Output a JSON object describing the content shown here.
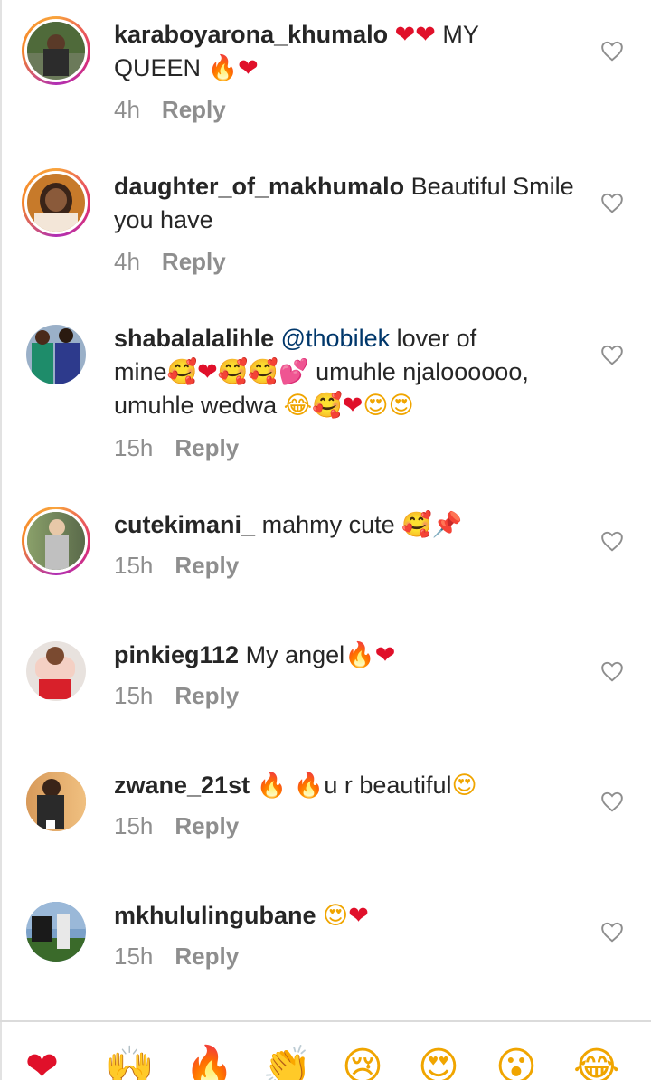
{
  "comments": [
    {
      "username": "karaboyarona_khumalo",
      "parts": [
        {
          "kind": "emoji",
          "icon": "heart",
          "char": "❤"
        },
        {
          "kind": "emoji",
          "icon": "heart",
          "char": "❤"
        },
        {
          "kind": "text",
          "value": " MY"
        }
      ],
      "line2": [
        {
          "kind": "text",
          "value": "QUEEN "
        },
        {
          "kind": "emoji",
          "icon": "fire",
          "char": "🔥"
        },
        {
          "kind": "emoji",
          "icon": "heart",
          "char": "❤"
        }
      ],
      "time": "4h",
      "reply": "Reply",
      "story_ring": true,
      "avatar_colors": [
        "#3d5a2e",
        "#7a6a4a",
        "#c9a98a",
        "#2c2c2c"
      ]
    },
    {
      "username": "daughter_of_makhumalo",
      "text": " Beautiful Smile",
      "line2_text": "you have",
      "time": "4h",
      "reply": "Reply",
      "story_ring": true,
      "avatar_colors": [
        "#c77a2a",
        "#3a2418",
        "#f3e6d8",
        "#1a1a1a"
      ]
    },
    {
      "username": "shabalalalihle",
      "mention": "@thobilek",
      "text": " lover of",
      "line2_text": "mine",
      "line2_emojis": [
        "🥰",
        "❤",
        "🥰",
        "🥰",
        "💕"
      ],
      "line2_after": " umuhle njaloooooo,",
      "line3_text": "umuhle wedwa ",
      "line3_emojis": [
        "😂",
        "🥰",
        "❤",
        "😍",
        "😍"
      ],
      "time": "15h",
      "reply": "Reply",
      "story_ring": false,
      "avatar_colors": [
        "#5a7ca8",
        "#1e8c6a",
        "#2d3a8c",
        "#1a1a1a"
      ]
    },
    {
      "username": "cutekimani_",
      "text": " mahmy cute ",
      "emojis": [
        "🥰",
        "📌"
      ],
      "time": "15h",
      "reply": "Reply",
      "story_ring": true,
      "avatar_colors": [
        "#8aa06a",
        "#e7c8a8",
        "#c0c0c0",
        "#5a6a4a"
      ]
    },
    {
      "username": "pinkieg112",
      "text": " My angel",
      "emojis": [
        "🔥",
        "❤"
      ],
      "time": "15h",
      "reply": "Reply",
      "story_ring": false,
      "avatar_colors": [
        "#e8e2de",
        "#d8202a",
        "#7a4a30",
        "#f4d0c4"
      ]
    },
    {
      "username": "zwane_21st",
      "text_before_emojis": " ",
      "emojis": [
        "🔥",
        "🔥"
      ],
      "text": "u r beautiful",
      "trailing_emojis": [
        "😍"
      ],
      "time": "15h",
      "reply": "Reply",
      "story_ring": false,
      "avatar_colors": [
        "#d89a5a",
        "#2a2a2a",
        "#f0c080",
        "#ffffff"
      ]
    },
    {
      "username": "mkhululingubane",
      "text": " ",
      "emojis": [
        "😍",
        "❤"
      ],
      "time": "15h",
      "reply": "Reply",
      "story_ring": false,
      "avatar_colors": [
        "#7aa0c8",
        "#3a6a2a",
        "#1a1a1a",
        "#e8e8e8"
      ]
    }
  ],
  "reactions": [
    {
      "icon": "red-heart-icon",
      "char": "❤"
    },
    {
      "icon": "raising-hands-icon",
      "char": "🙌"
    },
    {
      "icon": "fire-icon",
      "char": "🔥"
    },
    {
      "icon": "clapping-hands-icon",
      "char": "👏"
    },
    {
      "icon": "crying-face-icon",
      "char": "😢"
    },
    {
      "icon": "heart-eyes-icon",
      "char": "😍"
    },
    {
      "icon": "surprised-face-icon",
      "char": "😮"
    },
    {
      "icon": "tears-of-joy-icon",
      "char": "😂"
    }
  ]
}
